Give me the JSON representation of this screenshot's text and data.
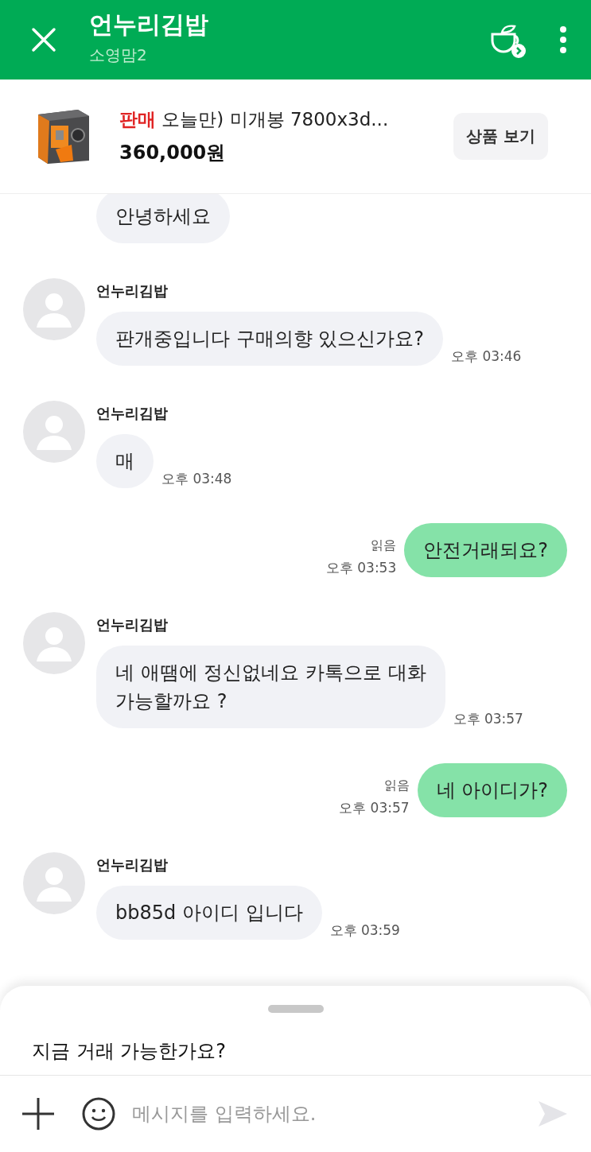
{
  "header": {
    "title": "언누리김밥",
    "subtitle": "소영맘2"
  },
  "product": {
    "status": "판매",
    "title": "오늘만) 미개봉 7800x3d...",
    "price": "360,000원",
    "button": "상품 보기",
    "kind": "picture"
  },
  "messages": [
    {
      "kind": "incoming",
      "lines": [
        "안녕하세요"
      ]
    },
    {
      "kind": "incoming",
      "sender": "언누리김밥",
      "lines": [
        "판개중입니다 구매의향 있으신가요?"
      ],
      "time": "오후 03:46"
    },
    {
      "kind": "incoming",
      "sender": "언누리김밥",
      "lines": [
        "매"
      ],
      "time": "오후 03:48"
    },
    {
      "kind": "outgoing",
      "read": "읽음",
      "lines": [
        "안전거래되요?"
      ],
      "time": "오후 03:53"
    },
    {
      "kind": "incoming",
      "sender": "언누리김밥",
      "lines": [
        "네 애땜에 정신없네요  카톡으로 대화",
        "가능할까요 ?"
      ],
      "time": "오후 03:57"
    },
    {
      "kind": "outgoing",
      "read": "읽음",
      "lines": [
        "네 아이디가?"
      ],
      "time": "오후 03:57"
    },
    {
      "kind": "incoming",
      "sender": "언누리김밥",
      "lines": [
        "bb85d 아이디 입니다"
      ],
      "time": "오후 03:59"
    }
  ],
  "suggestion": "지금 거래 가능한가요?",
  "composer": {
    "placeholder": "메시지를 입력하세요."
  }
}
